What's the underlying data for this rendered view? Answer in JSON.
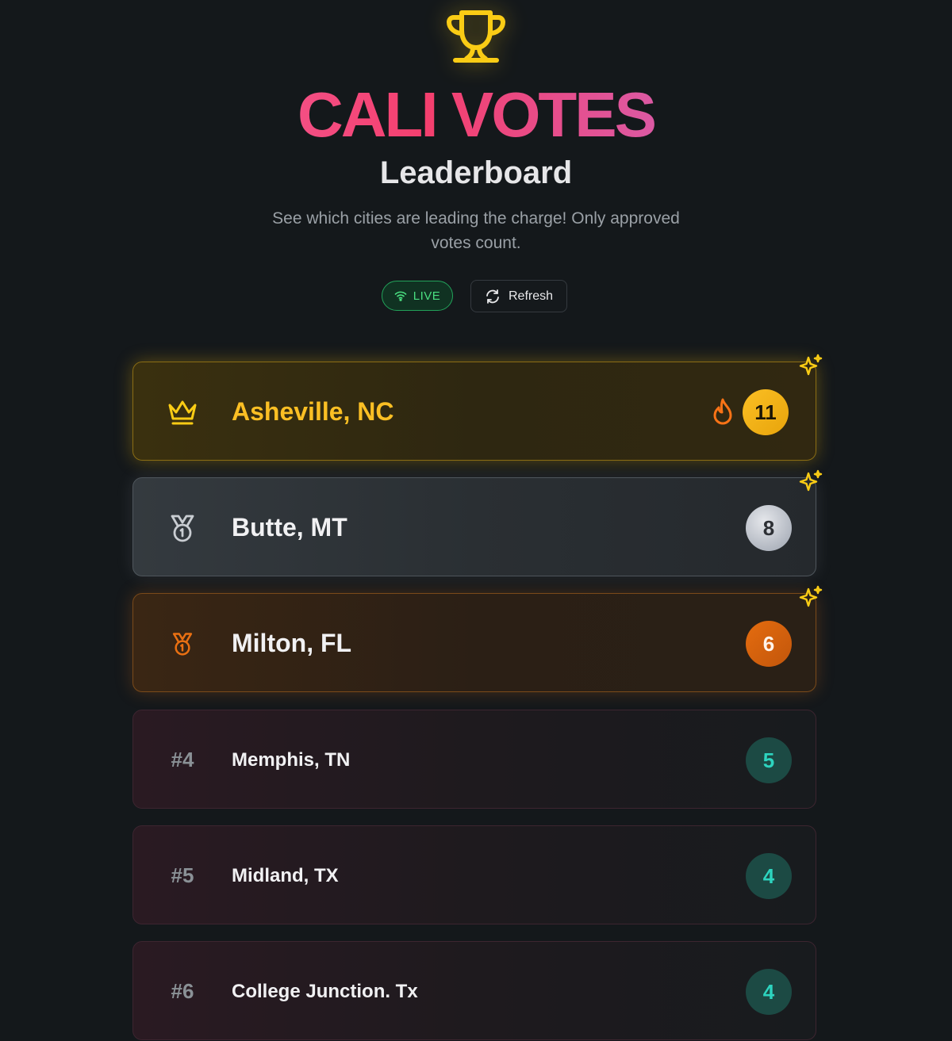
{
  "header": {
    "title": "CALI VOTES",
    "subtitle": "Leaderboard",
    "description": "See which cities are leading the charge! Only approved votes count.",
    "trophy_icon": "trophy-icon"
  },
  "controls": {
    "live_label": "LIVE",
    "live_icon": "wifi-icon",
    "refresh_label": "Refresh",
    "refresh_icon": "refresh-icon"
  },
  "colors": {
    "background": "#14181b",
    "gold": "#fbbf24",
    "silver": "#d1d5db",
    "bronze": "#ea7012",
    "teal": "#2dd4bf",
    "live_green": "#4ade80"
  },
  "leaderboard": [
    {
      "rank": "1",
      "rank_icon": "crown-icon",
      "city": "Asheville, NC",
      "votes": "11",
      "badge_icon": "fire-icon",
      "sparkle_icon": "sparkle-icon"
    },
    {
      "rank": "2",
      "rank_icon": "silver-medal-icon",
      "city": "Butte, MT",
      "votes": "8",
      "sparkle_icon": "sparkle-icon"
    },
    {
      "rank": "3",
      "rank_icon": "bronze-medal-icon",
      "city": "Milton, FL",
      "votes": "6",
      "sparkle_icon": "sparkle-icon"
    },
    {
      "rank": "#4",
      "city": "Memphis, TN",
      "votes": "5"
    },
    {
      "rank": "#5",
      "city": "Midland, TX",
      "votes": "4"
    },
    {
      "rank": "#6",
      "city": "College Junction. Tx",
      "votes": "4"
    }
  ]
}
